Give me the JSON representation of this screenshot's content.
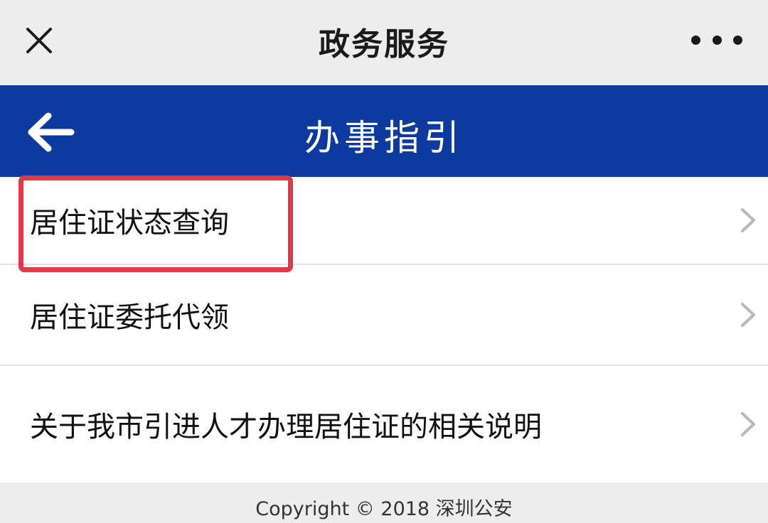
{
  "topbar": {
    "title": "政务服务",
    "close_icon": "close-icon",
    "more_icon": "more-dots-icon"
  },
  "navbar": {
    "title": "办事指引",
    "back_icon": "arrow-left-icon",
    "background_color": "#0d3a9e"
  },
  "list": {
    "items": [
      {
        "label": "居住证状态查询",
        "highlighted": true
      },
      {
        "label": "居住证委托代领",
        "highlighted": false
      },
      {
        "label": "关于我市引进人才办理居住证的相关说明",
        "highlighted": false
      }
    ],
    "chevron_icon": "chevron-right-icon",
    "highlight_color": "#e03a4a"
  },
  "footer": {
    "text": "Copyright © 2018 深圳公安"
  }
}
